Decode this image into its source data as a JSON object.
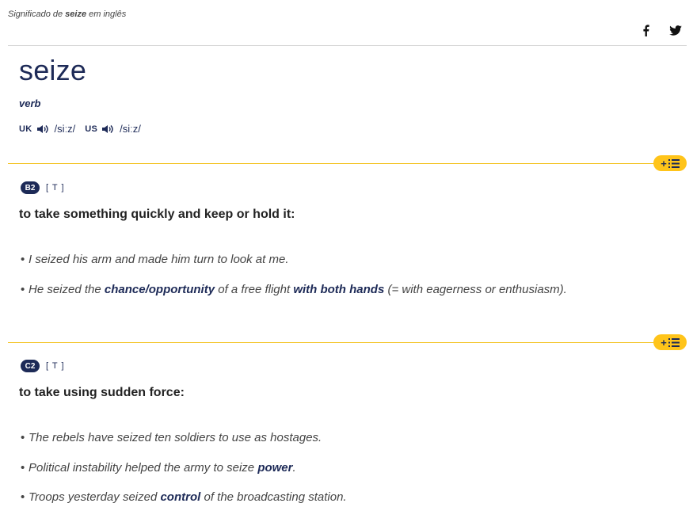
{
  "header": {
    "caption_prefix": "Significado de",
    "caption_word": "seize",
    "caption_suffix": "em inglês",
    "social": [
      {
        "name": "facebook-icon"
      },
      {
        "name": "twitter-icon"
      }
    ]
  },
  "entry": {
    "headword": "seize",
    "pos": "verb",
    "pron": {
      "uk_label": "UK",
      "uk_ipa": "/siːz/",
      "us_label": "US",
      "us_ipa": "/siːz/"
    }
  },
  "senses": [
    {
      "level": "B2",
      "grammar": "[ T ]",
      "definition": "to take something quickly and keep or hold it:",
      "add_label": "+",
      "examples": [
        {
          "parts": [
            "I seized his arm and made him turn to look at me."
          ]
        },
        {
          "parts": [
            "He seized the ",
            "chance/opportunity",
            " of a free flight ",
            "with both hands",
            " (= with eagerness or enthusiasm)."
          ]
        }
      ]
    },
    {
      "level": "C2",
      "grammar": "[ T ]",
      "definition": "to take using sudden force:",
      "add_label": "+",
      "examples": [
        {
          "parts": [
            "The rebels have seized ten soldiers to use as hostages."
          ]
        },
        {
          "parts": [
            "Political instability helped the army to seize ",
            "power",
            "."
          ]
        },
        {
          "parts": [
            "Troops yesterday seized ",
            "control",
            " of the broadcasting station."
          ]
        }
      ]
    }
  ],
  "colors": {
    "navy": "#1d2a57",
    "accent_yellow": "#ffc41a",
    "rule_yellow": "#f3c019"
  }
}
